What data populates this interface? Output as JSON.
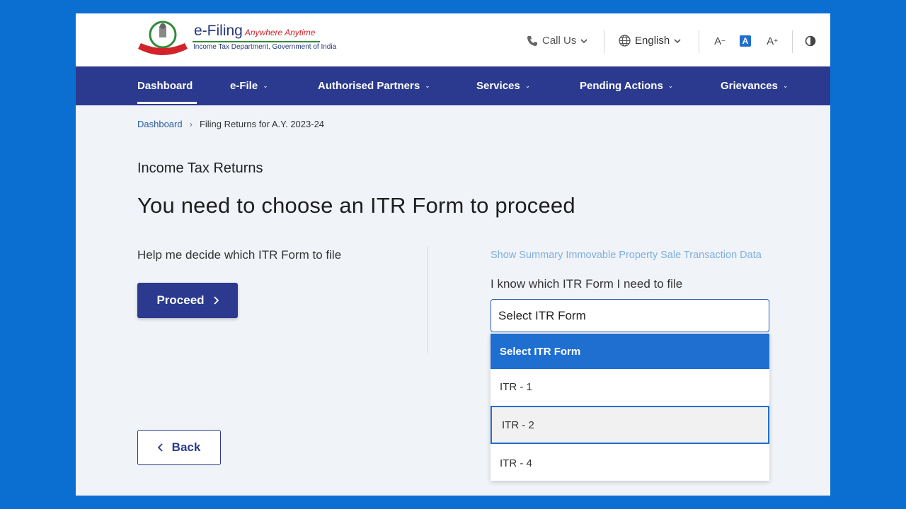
{
  "brand": {
    "title": "e-Filing",
    "tagline": "Anywhere Anytime",
    "subtitle": "Income Tax Department, Government of India",
    "emblem_icon": "india-emblem-icon"
  },
  "header": {
    "call_us": "Call Us",
    "language": "English",
    "font_decrease": "A",
    "font_normal": "A",
    "font_increase": "A",
    "icons": [
      "phone-icon",
      "globe-icon",
      "chevron-down-icon",
      "contrast-icon"
    ]
  },
  "nav": {
    "items": [
      {
        "label": "Dashboard",
        "active": true
      },
      {
        "label": "e-File"
      },
      {
        "label": "Authorised Partners"
      },
      {
        "label": "Services"
      },
      {
        "label": "Pending Actions"
      },
      {
        "label": "Grievances"
      }
    ]
  },
  "breadcrumb": {
    "home": "Dashboard",
    "current": "Filing Returns for A.Y. 2023-24"
  },
  "main": {
    "section_title": "Income Tax Returns",
    "page_title": "You need to choose an ITR Form to proceed",
    "left": {
      "help_text": "Help me decide which ITR Form to file",
      "proceed_label": "Proceed"
    },
    "right": {
      "summary_link": "Show Summary Immovable Property Sale Transaction Data",
      "select_label": "I know which ITR Form I need to file",
      "select_value": "Select ITR Form",
      "options": [
        {
          "label": "Select ITR Form",
          "state": "selected"
        },
        {
          "label": "ITR - 1",
          "state": "normal"
        },
        {
          "label": "ITR - 2",
          "state": "hover"
        },
        {
          "label": "ITR - 4",
          "state": "normal"
        }
      ]
    },
    "back_label": "Back"
  },
  "colors": {
    "nav_bg": "#2b3a8e",
    "accent": "#1f6fd1",
    "page_bg": "#f0f3f8",
    "outer_bg": "#0b6fd1",
    "link": "#7fb0dc"
  }
}
